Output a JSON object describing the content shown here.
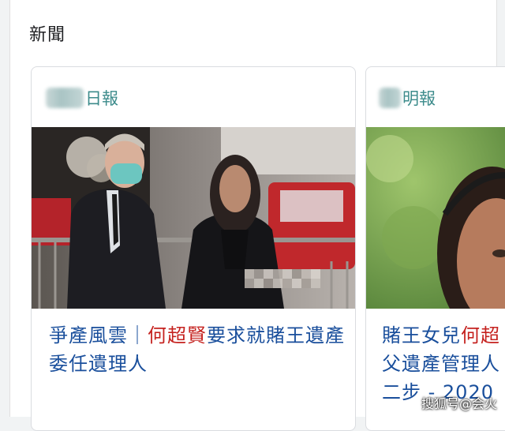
{
  "section": {
    "title": "新聞"
  },
  "cards": [
    {
      "source_suffix": "日報",
      "headline_part1": "爭產風雲｜",
      "headline_highlight": "何超賢",
      "headline_part2": "要求就賭王遺產委任遺理人"
    },
    {
      "source_suffix": "明報",
      "headline_line1_part1": "賭王女兒",
      "headline_line1_highlight": "何超",
      "headline_line2": "父遺產管理人",
      "headline_line3": "二步 - 2020"
    }
  ],
  "watermark": {
    "text": "搜狐号@会火"
  },
  "icons": {
    "source_logo_1": "blurred-logo-icon",
    "source_logo_2": "blurred-logo-icon"
  },
  "colors": {
    "source_text": "#3c8b8b",
    "headline_text": "#1a4f9c",
    "highlight_text": "#c5221f",
    "card_border": "#dadce0"
  }
}
